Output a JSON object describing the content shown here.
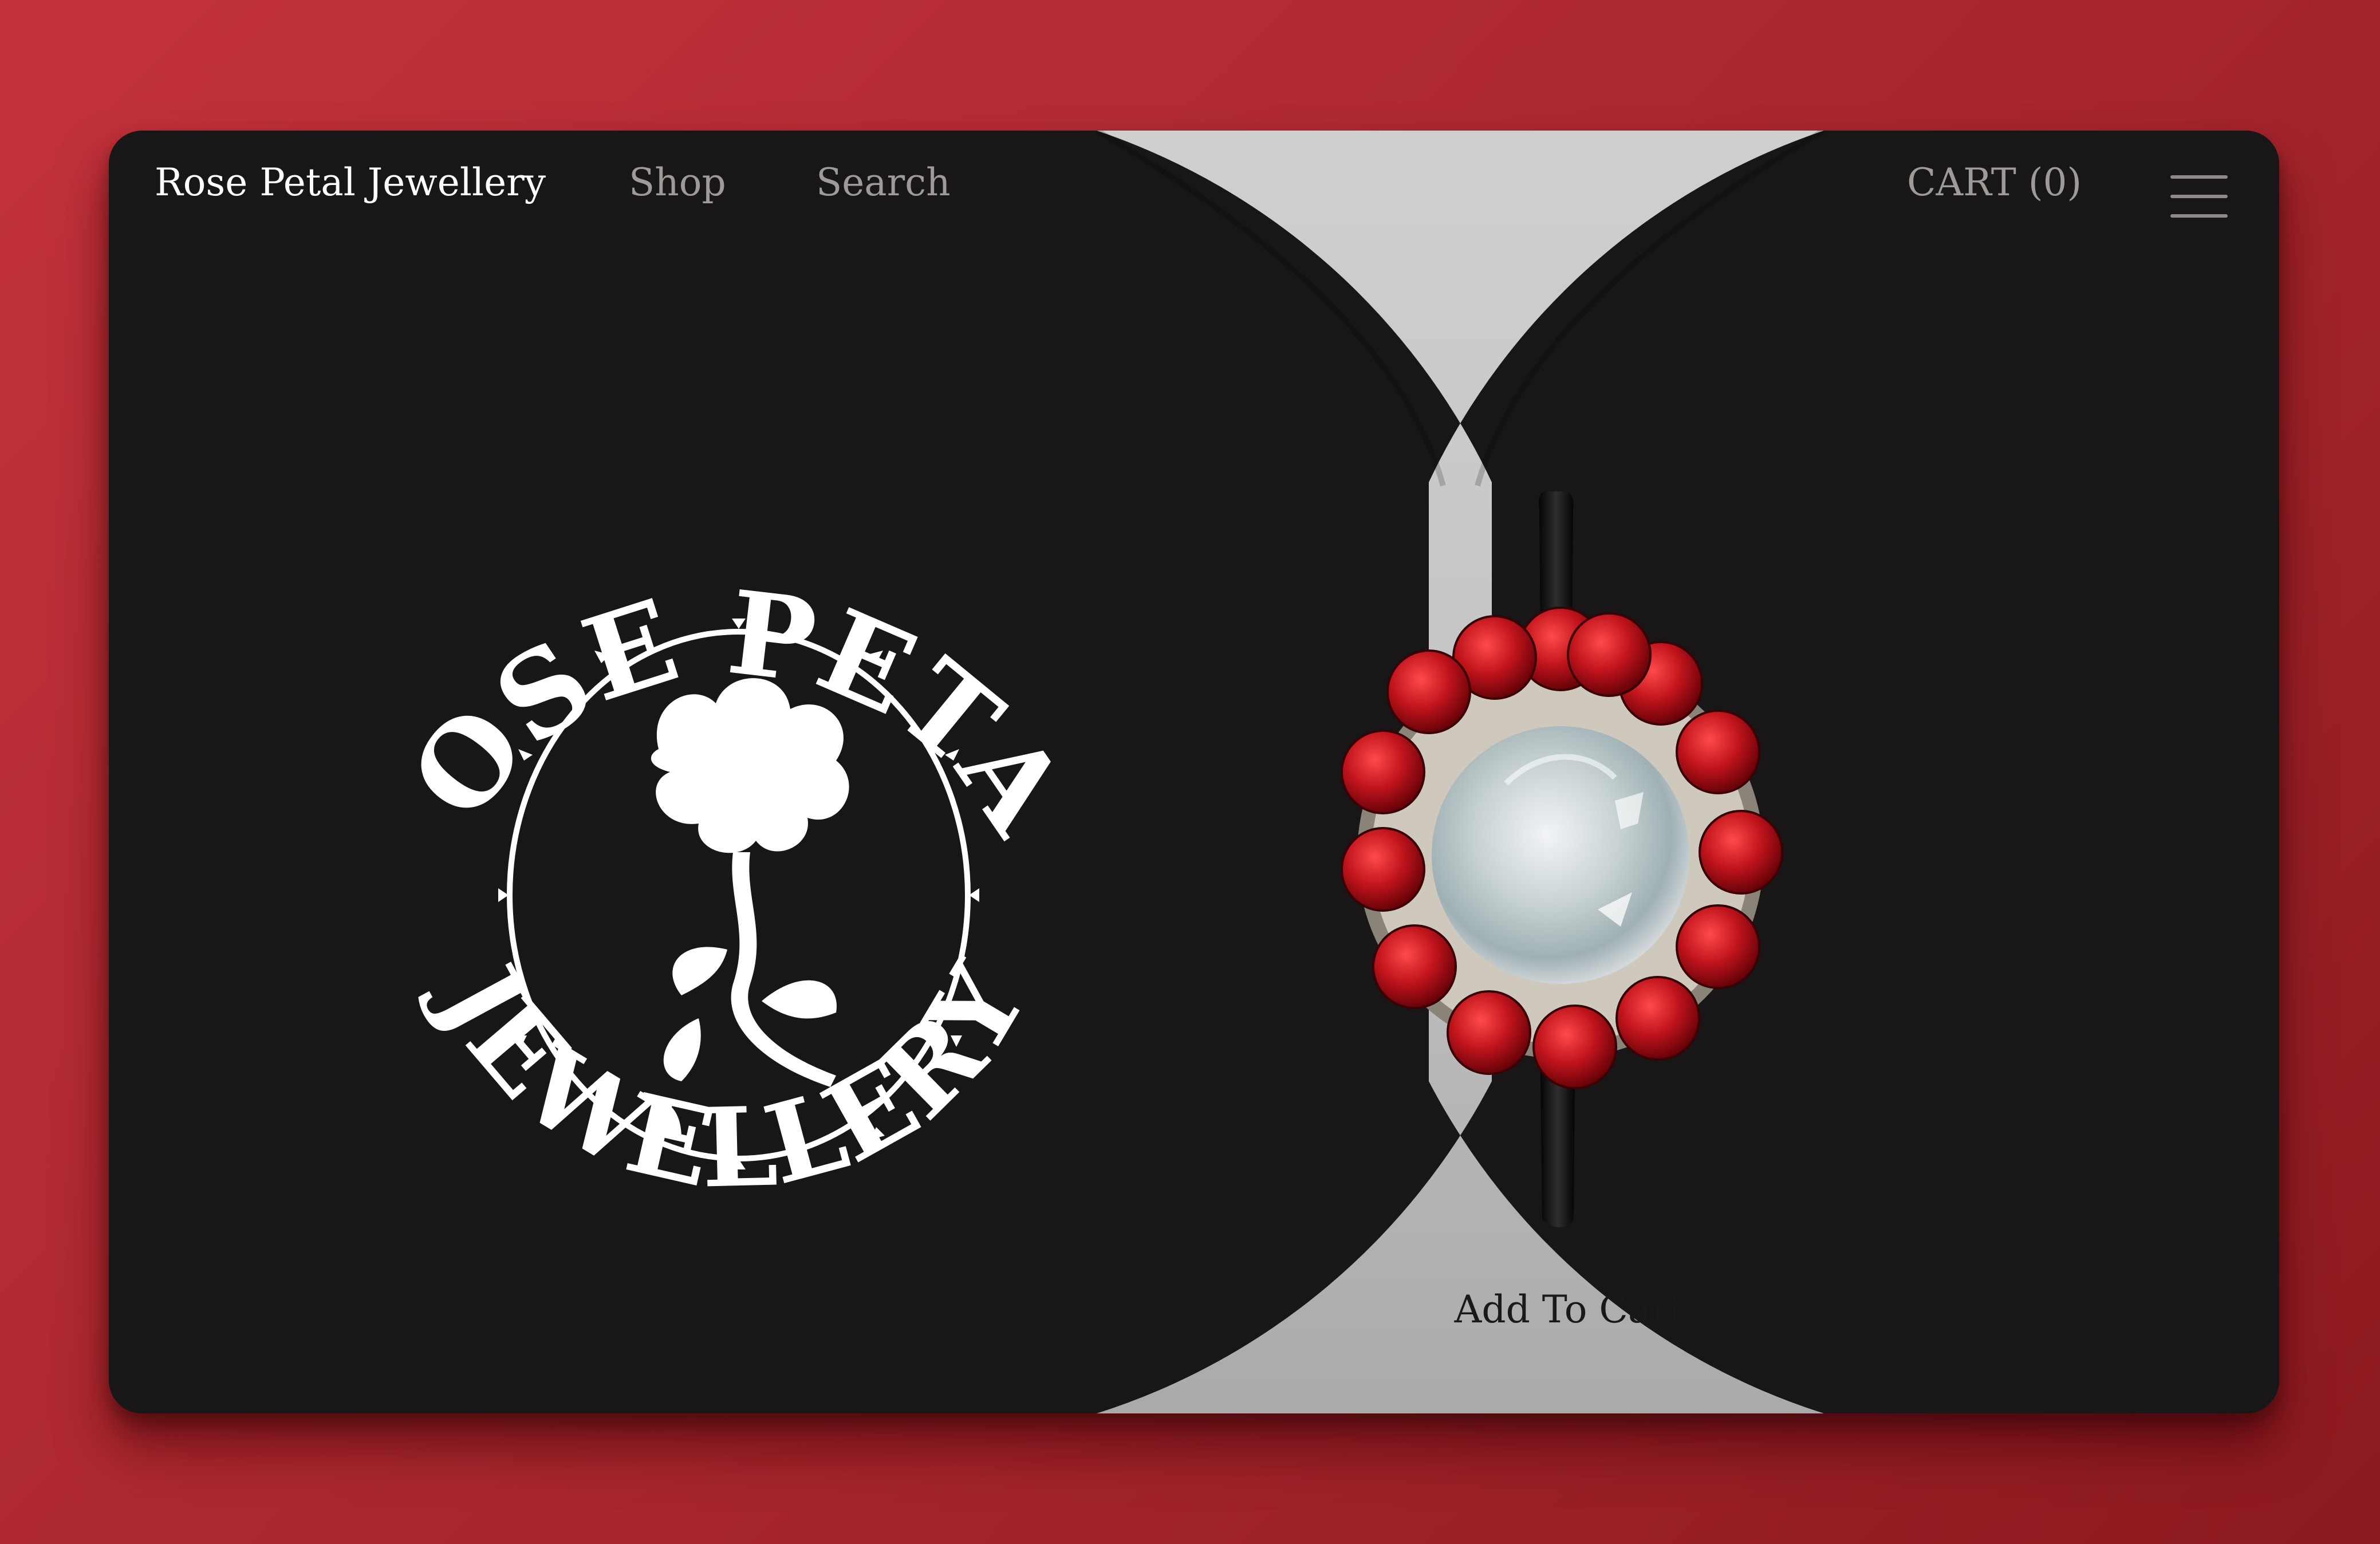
{
  "nav": {
    "brand": "Rose Petal Jewellery",
    "shop_label": "Shop",
    "search_label": "Search",
    "cart_label": "CART (0)",
    "menu_icon": "hamburger-menu-icon"
  },
  "logo": {
    "top_text": "ROSE PETAL",
    "bottom_text": "JEWELLERY",
    "emblem_icon": "rose-icon"
  },
  "product": {
    "image_icon": "ruby-opal-ring",
    "add_to_cart_label": "Add To Cart"
  },
  "colors": {
    "page_background": "#b3262e",
    "card_background": "#181616",
    "hourglass_panel": "#c8c8c8",
    "gem_red": "#c0141c",
    "text_primary": "#ffffff",
    "text_muted": "#9e9a98"
  }
}
